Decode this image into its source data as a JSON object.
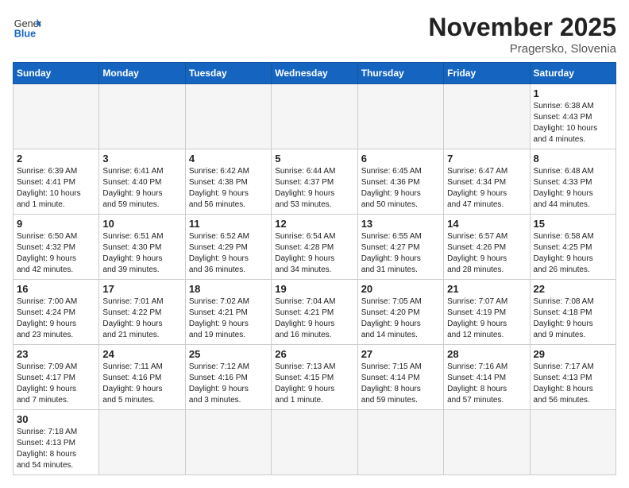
{
  "header": {
    "logo_general": "General",
    "logo_blue": "Blue",
    "month_title": "November 2025",
    "location": "Pragersko, Slovenia"
  },
  "weekdays": [
    "Sunday",
    "Monday",
    "Tuesday",
    "Wednesday",
    "Thursday",
    "Friday",
    "Saturday"
  ],
  "weeks": [
    [
      {
        "day": "",
        "info": "",
        "empty": true
      },
      {
        "day": "",
        "info": "",
        "empty": true
      },
      {
        "day": "",
        "info": "",
        "empty": true
      },
      {
        "day": "",
        "info": "",
        "empty": true
      },
      {
        "day": "",
        "info": "",
        "empty": true
      },
      {
        "day": "",
        "info": "",
        "empty": true
      },
      {
        "day": "1",
        "info": "Sunrise: 6:38 AM\nSunset: 4:43 PM\nDaylight: 10 hours\nand 4 minutes.",
        "empty": false
      }
    ],
    [
      {
        "day": "2",
        "info": "Sunrise: 6:39 AM\nSunset: 4:41 PM\nDaylight: 10 hours\nand 1 minute.",
        "empty": false
      },
      {
        "day": "3",
        "info": "Sunrise: 6:41 AM\nSunset: 4:40 PM\nDaylight: 9 hours\nand 59 minutes.",
        "empty": false
      },
      {
        "day": "4",
        "info": "Sunrise: 6:42 AM\nSunset: 4:38 PM\nDaylight: 9 hours\nand 56 minutes.",
        "empty": false
      },
      {
        "day": "5",
        "info": "Sunrise: 6:44 AM\nSunset: 4:37 PM\nDaylight: 9 hours\nand 53 minutes.",
        "empty": false
      },
      {
        "day": "6",
        "info": "Sunrise: 6:45 AM\nSunset: 4:36 PM\nDaylight: 9 hours\nand 50 minutes.",
        "empty": false
      },
      {
        "day": "7",
        "info": "Sunrise: 6:47 AM\nSunset: 4:34 PM\nDaylight: 9 hours\nand 47 minutes.",
        "empty": false
      },
      {
        "day": "8",
        "info": "Sunrise: 6:48 AM\nSunset: 4:33 PM\nDaylight: 9 hours\nand 44 minutes.",
        "empty": false
      }
    ],
    [
      {
        "day": "9",
        "info": "Sunrise: 6:50 AM\nSunset: 4:32 PM\nDaylight: 9 hours\nand 42 minutes.",
        "empty": false
      },
      {
        "day": "10",
        "info": "Sunrise: 6:51 AM\nSunset: 4:30 PM\nDaylight: 9 hours\nand 39 minutes.",
        "empty": false
      },
      {
        "day": "11",
        "info": "Sunrise: 6:52 AM\nSunset: 4:29 PM\nDaylight: 9 hours\nand 36 minutes.",
        "empty": false
      },
      {
        "day": "12",
        "info": "Sunrise: 6:54 AM\nSunset: 4:28 PM\nDaylight: 9 hours\nand 34 minutes.",
        "empty": false
      },
      {
        "day": "13",
        "info": "Sunrise: 6:55 AM\nSunset: 4:27 PM\nDaylight: 9 hours\nand 31 minutes.",
        "empty": false
      },
      {
        "day": "14",
        "info": "Sunrise: 6:57 AM\nSunset: 4:26 PM\nDaylight: 9 hours\nand 28 minutes.",
        "empty": false
      },
      {
        "day": "15",
        "info": "Sunrise: 6:58 AM\nSunset: 4:25 PM\nDaylight: 9 hours\nand 26 minutes.",
        "empty": false
      }
    ],
    [
      {
        "day": "16",
        "info": "Sunrise: 7:00 AM\nSunset: 4:24 PM\nDaylight: 9 hours\nand 23 minutes.",
        "empty": false
      },
      {
        "day": "17",
        "info": "Sunrise: 7:01 AM\nSunset: 4:22 PM\nDaylight: 9 hours\nand 21 minutes.",
        "empty": false
      },
      {
        "day": "18",
        "info": "Sunrise: 7:02 AM\nSunset: 4:21 PM\nDaylight: 9 hours\nand 19 minutes.",
        "empty": false
      },
      {
        "day": "19",
        "info": "Sunrise: 7:04 AM\nSunset: 4:21 PM\nDaylight: 9 hours\nand 16 minutes.",
        "empty": false
      },
      {
        "day": "20",
        "info": "Sunrise: 7:05 AM\nSunset: 4:20 PM\nDaylight: 9 hours\nand 14 minutes.",
        "empty": false
      },
      {
        "day": "21",
        "info": "Sunrise: 7:07 AM\nSunset: 4:19 PM\nDaylight: 9 hours\nand 12 minutes.",
        "empty": false
      },
      {
        "day": "22",
        "info": "Sunrise: 7:08 AM\nSunset: 4:18 PM\nDaylight: 9 hours\nand 9 minutes.",
        "empty": false
      }
    ],
    [
      {
        "day": "23",
        "info": "Sunrise: 7:09 AM\nSunset: 4:17 PM\nDaylight: 9 hours\nand 7 minutes.",
        "empty": false
      },
      {
        "day": "24",
        "info": "Sunrise: 7:11 AM\nSunset: 4:16 PM\nDaylight: 9 hours\nand 5 minutes.",
        "empty": false
      },
      {
        "day": "25",
        "info": "Sunrise: 7:12 AM\nSunset: 4:16 PM\nDaylight: 9 hours\nand 3 minutes.",
        "empty": false
      },
      {
        "day": "26",
        "info": "Sunrise: 7:13 AM\nSunset: 4:15 PM\nDaylight: 9 hours\nand 1 minute.",
        "empty": false
      },
      {
        "day": "27",
        "info": "Sunrise: 7:15 AM\nSunset: 4:14 PM\nDaylight: 8 hours\nand 59 minutes.",
        "empty": false
      },
      {
        "day": "28",
        "info": "Sunrise: 7:16 AM\nSunset: 4:14 PM\nDaylight: 8 hours\nand 57 minutes.",
        "empty": false
      },
      {
        "day": "29",
        "info": "Sunrise: 7:17 AM\nSunset: 4:13 PM\nDaylight: 8 hours\nand 56 minutes.",
        "empty": false
      }
    ],
    [
      {
        "day": "30",
        "info": "Sunrise: 7:18 AM\nSunset: 4:13 PM\nDaylight: 8 hours\nand 54 minutes.",
        "empty": false
      },
      {
        "day": "",
        "info": "",
        "empty": true
      },
      {
        "day": "",
        "info": "",
        "empty": true
      },
      {
        "day": "",
        "info": "",
        "empty": true
      },
      {
        "day": "",
        "info": "",
        "empty": true
      },
      {
        "day": "",
        "info": "",
        "empty": true
      },
      {
        "day": "",
        "info": "",
        "empty": true
      }
    ]
  ]
}
